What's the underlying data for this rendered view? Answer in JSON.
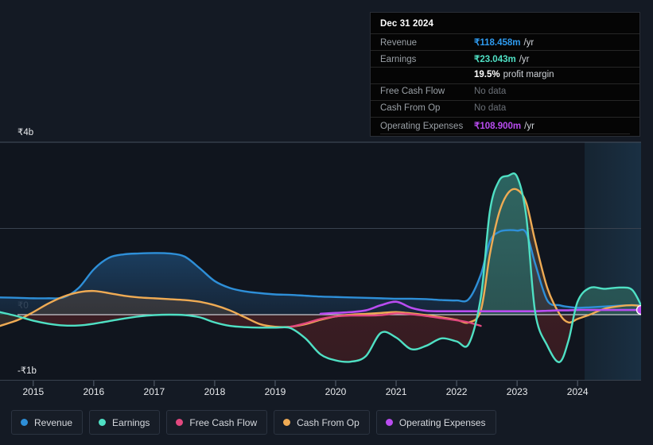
{
  "tooltip": {
    "title": "Dec 31 2024",
    "rows": [
      {
        "label": "Revenue",
        "value": "₹118.458m",
        "unit": "/yr",
        "color": "#2e9bf0",
        "nodata": false
      },
      {
        "label": "Earnings",
        "value": "₹23.043m",
        "unit": "/yr",
        "color": "#4fe0c4",
        "nodata": false
      },
      {
        "label": "",
        "value": "19.5%",
        "unit": "profit margin",
        "color": "#ffffff",
        "nodata": false
      },
      {
        "label": "Free Cash Flow",
        "value": "No data",
        "unit": "",
        "color": "#6b7077",
        "nodata": true
      },
      {
        "label": "Cash From Op",
        "value": "No data",
        "unit": "",
        "color": "#6b7077",
        "nodata": true
      },
      {
        "label": "Operating Expenses",
        "value": "₹108.900m",
        "unit": "/yr",
        "color": "#b94cf0",
        "nodata": false
      }
    ]
  },
  "legend": {
    "items": [
      {
        "label": "Revenue",
        "color": "#2e8fd8"
      },
      {
        "label": "Earnings",
        "color": "#4fe0c4"
      },
      {
        "label": "Free Cash Flow",
        "color": "#e2487f"
      },
      {
        "label": "Cash From Op",
        "color": "#efab54"
      },
      {
        "label": "Operating Expenses",
        "color": "#b94cf0"
      }
    ]
  },
  "chart_data": {
    "type": "area",
    "title": "",
    "xlabel": "",
    "ylabel": "",
    "currency": "₹",
    "units": "billions",
    "grid": true,
    "legend_position": "bottom",
    "ylim": [
      -1.4,
      4.0
    ],
    "xlim": [
      2014.45,
      2025.05
    ],
    "yticks": [
      4,
      2,
      0,
      -1
    ],
    "ytick_labels": [
      "₹4b",
      "",
      "₹0",
      "-₹1b"
    ],
    "gridline_values": [
      4,
      2,
      0,
      -1
    ],
    "xticks": [
      2015,
      2016,
      2017,
      2018,
      2019,
      2020,
      2021,
      2022,
      2023,
      2024
    ],
    "xtick_labels": [
      "2015",
      "2016",
      "2017",
      "2018",
      "2019",
      "2020",
      "2021",
      "2022",
      "2023",
      "2024"
    ],
    "forecast_zone_start": 2024.0,
    "x": [
      2014.45,
      2014.75,
      2015.0,
      2015.25,
      2015.5,
      2015.75,
      2016.0,
      2016.25,
      2016.5,
      2016.75,
      2017.0,
      2017.25,
      2017.5,
      2017.75,
      2018.0,
      2018.25,
      2018.5,
      2018.75,
      2019.0,
      2019.25,
      2019.5,
      2019.75,
      2020.0,
      2020.25,
      2020.5,
      2020.75,
      2021.0,
      2021.25,
      2021.5,
      2021.75,
      2022.0,
      2022.2,
      2022.4,
      2022.55,
      2022.7,
      2022.85,
      2023.0,
      2023.15,
      2023.3,
      2023.5,
      2023.7,
      2023.85,
      2024.0,
      2024.2,
      2024.45,
      2024.7,
      2024.9,
      2025.05
    ],
    "series": [
      {
        "name": "Revenue",
        "color": "#2e8fd8",
        "fill": "#19344f",
        "values": [
          0.4,
          0.39,
          0.38,
          0.38,
          0.4,
          0.62,
          1.05,
          1.32,
          1.4,
          1.42,
          1.43,
          1.42,
          1.35,
          1.08,
          0.78,
          0.62,
          0.54,
          0.5,
          0.47,
          0.46,
          0.44,
          0.42,
          0.41,
          0.4,
          0.39,
          0.38,
          0.37,
          0.37,
          0.36,
          0.34,
          0.33,
          0.36,
          0.93,
          1.7,
          1.92,
          1.96,
          1.95,
          1.9,
          1.18,
          0.33,
          0.22,
          0.18,
          0.16,
          0.17,
          0.19,
          0.21,
          0.22,
          0.22
        ]
      },
      {
        "name": "Earnings",
        "color": "#4fe0c4",
        "fill_positive": "#2d5f5d",
        "fill_negative": "#3d1f24",
        "values": [
          0.06,
          -0.04,
          -0.14,
          -0.21,
          -0.25,
          -0.25,
          -0.21,
          -0.15,
          -0.09,
          -0.04,
          -0.01,
          0.0,
          -0.01,
          -0.06,
          -0.18,
          -0.26,
          -0.29,
          -0.3,
          -0.3,
          -0.31,
          -0.55,
          -0.92,
          -1.06,
          -1.09,
          -0.96,
          -0.42,
          -0.53,
          -0.8,
          -0.72,
          -0.55,
          -0.62,
          -0.68,
          0.4,
          2.4,
          3.1,
          3.22,
          3.2,
          2.3,
          0.05,
          -0.72,
          -1.1,
          -0.6,
          0.3,
          0.62,
          0.6,
          0.63,
          0.58,
          0.22
        ]
      },
      {
        "name": "Free Cash Flow",
        "color": "#e2487f",
        "values": [
          null,
          null,
          null,
          null,
          null,
          null,
          null,
          null,
          null,
          null,
          null,
          null,
          null,
          null,
          null,
          null,
          null,
          -0.3,
          -0.3,
          -0.28,
          -0.2,
          -0.1,
          -0.04,
          -0.02,
          -0.02,
          -0.01,
          0.03,
          0.01,
          -0.03,
          -0.08,
          -0.13,
          -0.18,
          -0.26,
          null,
          null,
          null,
          null,
          null,
          null,
          null,
          null,
          null,
          null,
          null,
          null,
          null,
          null,
          null
        ]
      },
      {
        "name": "Cash From Op",
        "color": "#efab54",
        "values": [
          -0.26,
          -0.12,
          0.06,
          0.26,
          0.42,
          0.52,
          0.55,
          0.5,
          0.44,
          0.4,
          0.38,
          0.36,
          0.34,
          0.3,
          0.22,
          0.1,
          -0.06,
          -0.22,
          -0.28,
          -0.28,
          -0.22,
          -0.12,
          -0.04,
          0.0,
          0.02,
          0.04,
          0.06,
          0.03,
          -0.01,
          -0.06,
          -0.12,
          -0.18,
          0.1,
          1.4,
          2.35,
          2.82,
          2.9,
          2.6,
          1.7,
          0.62,
          0.02,
          -0.18,
          -0.1,
          0.0,
          0.14,
          0.2,
          0.22,
          0.2
        ]
      },
      {
        "name": "Operating Expenses",
        "color": "#b94cf0",
        "values": [
          null,
          null,
          null,
          null,
          null,
          null,
          null,
          null,
          null,
          null,
          null,
          null,
          null,
          null,
          null,
          null,
          null,
          null,
          null,
          null,
          null,
          0.02,
          0.04,
          0.06,
          0.1,
          0.22,
          0.3,
          0.16,
          0.09,
          0.08,
          0.08,
          0.08,
          0.08,
          0.08,
          0.08,
          0.08,
          0.08,
          0.08,
          0.08,
          0.09,
          0.1,
          0.1,
          0.11,
          0.11,
          0.11,
          0.11,
          0.11,
          0.11
        ]
      }
    ],
    "marker": {
      "series": "Operating Expenses",
      "x": 2025.05,
      "y": 0.11,
      "color": "#b94cf0"
    }
  }
}
